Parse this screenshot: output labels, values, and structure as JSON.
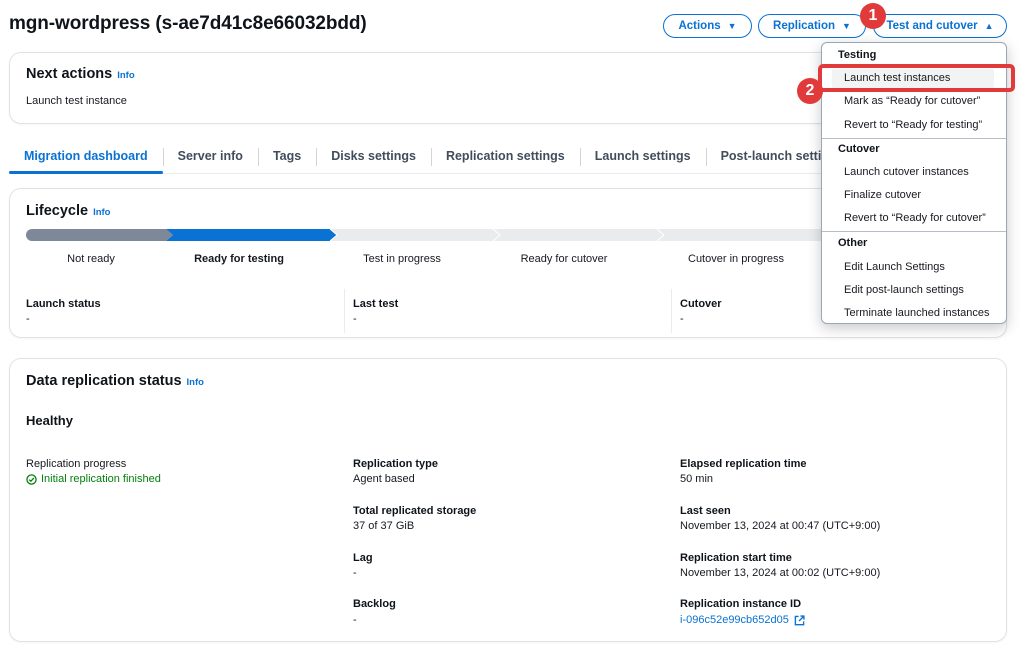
{
  "page": {
    "title": "mgn-wordpress (s-ae7d41c8e66032bdd)"
  },
  "header_buttons": {
    "actions": "Actions",
    "replication": "Replication",
    "test_cutover": "Test and cutover",
    "caret_down": "▼",
    "caret_up": "▲"
  },
  "next_actions": {
    "title": "Next actions",
    "info": "Info",
    "text": "Launch test instance"
  },
  "tabs": [
    "Migration dashboard",
    "Server info",
    "Tags",
    "Disks settings",
    "Replication settings",
    "Launch settings",
    "Post-launch setti"
  ],
  "lifecycle": {
    "title": "Lifecycle",
    "info": "Info",
    "stages": [
      "Not ready",
      "Ready for testing",
      "Test in progress",
      "Ready for cutover",
      "Cutover in progress"
    ],
    "fields": [
      {
        "label": "Launch status",
        "value": "-"
      },
      {
        "label": "Last test",
        "value": "-"
      },
      {
        "label": "Cutover",
        "value": "-"
      }
    ]
  },
  "replication": {
    "title": "Data replication status",
    "info": "Info",
    "health": "Healthy",
    "progress_label": "Replication progress",
    "progress_status": "Initial replication finished",
    "type_label": "Replication type",
    "type_value": "Agent based",
    "storage_label": "Total replicated storage",
    "storage_value": "37 of 37 GiB",
    "lag_label": "Lag",
    "lag_value": "-",
    "backlog_label": "Backlog",
    "backlog_value": "-",
    "elapsed_label": "Elapsed replication time",
    "elapsed_value": "50 min",
    "lastseen_label": "Last seen",
    "lastseen_value": "November 13, 2024 at 00:47 (UTC+9:00)",
    "start_label": "Replication start time",
    "start_value": "November 13, 2024 at 00:02 (UTC+9:00)",
    "instance_label": "Replication instance ID",
    "instance_value": "i-096c52e99cb652d05"
  },
  "menu": {
    "group_testing": "Testing",
    "launch_test": "Launch test instances",
    "mark_ready": "Mark as “Ready for cutover”",
    "revert_testing": "Revert to “Ready for testing”",
    "group_cutover": "Cutover",
    "launch_cutover": "Launch cutover instances",
    "finalize": "Finalize cutover",
    "revert_cutover": "Revert to “Ready for cutover”",
    "group_other": "Other",
    "edit_launch": "Edit Launch Settings",
    "edit_postlaunch": "Edit post-launch settings",
    "terminate": "Terminate launched instances"
  },
  "callouts": {
    "one": "1",
    "two": "2"
  },
  "colors": {
    "accent": "#0972d3",
    "success": "#037f0c",
    "callout": "#e03a3a",
    "progress_done": "#7d8998"
  }
}
